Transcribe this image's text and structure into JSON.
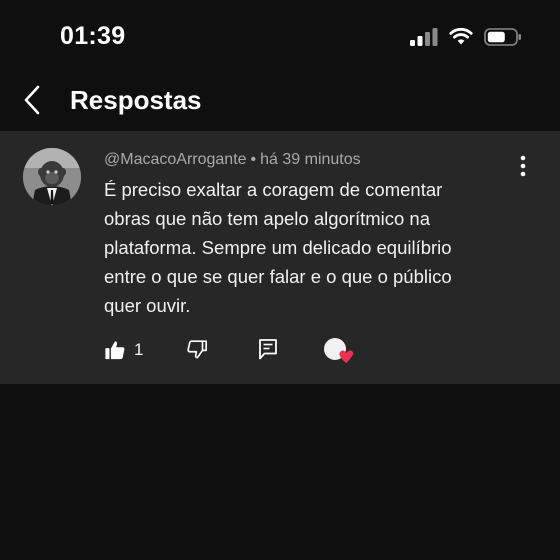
{
  "status_bar": {
    "time": "01:39",
    "icons": [
      "cellular-signal-icon",
      "wifi-icon",
      "battery-icon"
    ]
  },
  "header": {
    "title": "Respostas",
    "back_icon": "chevron-left-icon"
  },
  "comment": {
    "author": "@MacacoArrogante",
    "separator": "•",
    "timestamp": "há 39 minutos",
    "text_lines": [
      "É preciso exaltar a coragem de comentar",
      "obras que não tem apelo algorítmico na",
      "plataforma. Sempre um delicado equilíbrio",
      "entre o que se quer falar e o que o público",
      "quer ouvir."
    ],
    "like_count": "1",
    "actions": [
      "thumbs-up-icon",
      "thumbs-down-icon",
      "reply-icon",
      "creator-heart-icon"
    ],
    "more_icon": "more-vertical-icon"
  },
  "colors": {
    "background": "#0f0f0f",
    "card": "#272727",
    "text": "#f1f1f1",
    "secondary_text": "#aaaaaa",
    "heart": "#e8344e"
  }
}
